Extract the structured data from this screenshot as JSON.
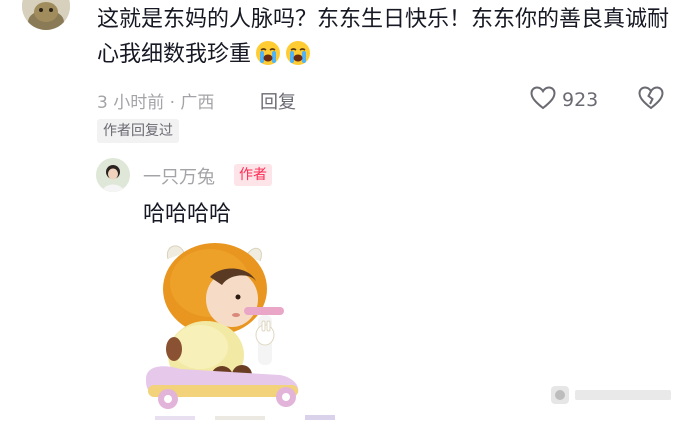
{
  "comment": {
    "text": "这就是东妈的人脉吗？东东生日快乐！东东你的善良真诚耐心我细数我珍重",
    "emoji_count": 2,
    "emoji_icon": "loudly-crying-face-icon",
    "meta": "3 小时前 · 广西",
    "reply_label": "回复",
    "like_count": "923",
    "author_replied_label": "作者回复过"
  },
  "reply": {
    "username": "一只万兔",
    "author_tag": "作者",
    "text": "哈哈哈哈",
    "sticker": "child-in-bear-costume-on-scooter-sticker"
  },
  "icons": {
    "like": "heart-outline-icon",
    "dislike": "broken-heart-outline-icon",
    "watermark": "weibo-watermark-icon"
  },
  "colors": {
    "accent": "#fe2c55",
    "text_primary": "#161823",
    "text_secondary": "#a4a4a8",
    "badge_bg": "#f2f2f3",
    "author_tag_bg": "#fce4e8"
  }
}
